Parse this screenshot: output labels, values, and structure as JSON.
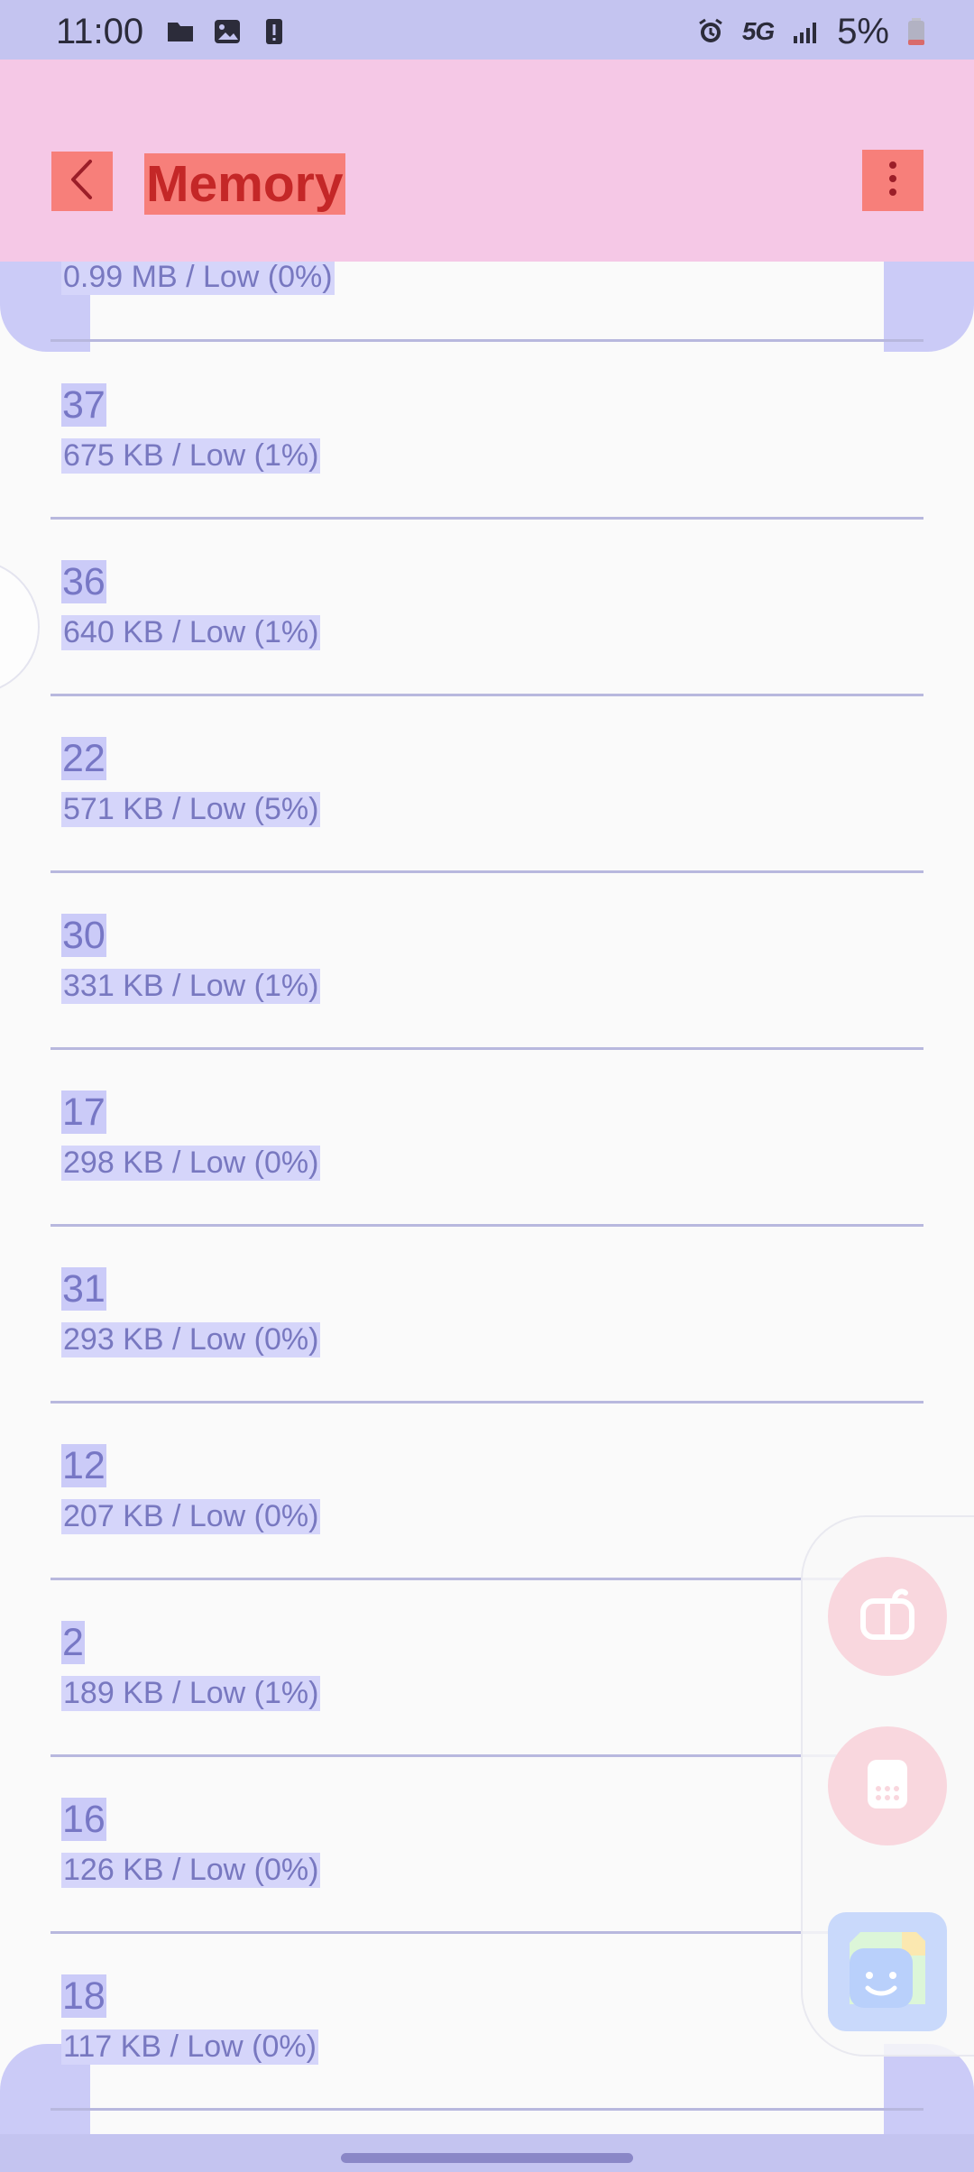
{
  "status_bar": {
    "time": "11:00",
    "network": "5G",
    "battery": "5%",
    "left_icons": [
      "folder-icon",
      "image-icon",
      "alert-icon"
    ],
    "right_icons": [
      "alarm-icon",
      "signal-icon",
      "battery-icon"
    ]
  },
  "app_bar": {
    "title": "Memory",
    "back_icon": "back-arrow-icon",
    "menu_icon": "more-options-icon",
    "background_color": "#f5c8e6",
    "button_color": "#f77f7a",
    "title_color": "#c42727"
  },
  "memory_list": [
    {
      "name": "",
      "detail": "0.99 MB / Low (0%)"
    },
    {
      "name": "37",
      "detail": "675 KB / Low (1%)"
    },
    {
      "name": "36",
      "detail": "640 KB / Low (1%)"
    },
    {
      "name": "22",
      "detail": "571 KB / Low (5%)"
    },
    {
      "name": "30",
      "detail": "331 KB / Low (1%)"
    },
    {
      "name": "17",
      "detail": "298 KB / Low (0%)"
    },
    {
      "name": "31",
      "detail": "293 KB / Low (0%)"
    },
    {
      "name": "12",
      "detail": "207 KB / Low (0%)"
    },
    {
      "name": "2",
      "detail": "189 KB / Low (1%)"
    },
    {
      "name": "16",
      "detail": "126 KB / Low (0%)"
    },
    {
      "name": "18",
      "detail": "117 KB / Low (0%)"
    }
  ],
  "colors": {
    "screen_background": "#c4c4f0",
    "list_background": "#fafafa",
    "divider": "#b8b8de",
    "text": "#7878c0"
  },
  "floating_panel": {
    "items": [
      "shopping-app-icon",
      "calculator-app-icon",
      "messaging-app-icon"
    ]
  }
}
